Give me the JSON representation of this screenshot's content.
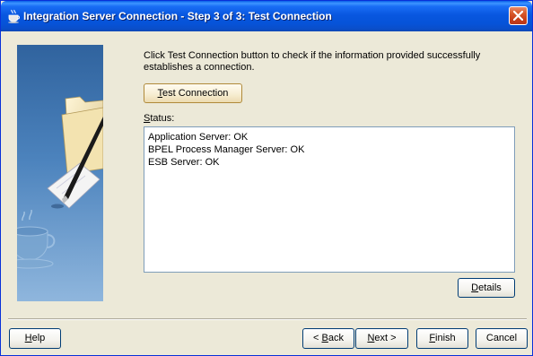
{
  "window": {
    "title": "Integration Server Connection - Step 3 of 3: Test Connection",
    "icon": "java-coffee-cup-icon",
    "close_icon": "close-x-icon",
    "accent_color": "#0a5fe8",
    "close_color": "#d85a2c"
  },
  "main": {
    "instructions_line1": "Click Test Connection button to check if the information provided successfully",
    "instructions_line2": "establishes a connection.",
    "test_button": {
      "mnemonic": "T",
      "rest": "est Connection"
    },
    "status_label": {
      "mnemonic": "S",
      "rest": "tatus:"
    },
    "status_lines": [
      "Application Server: OK",
      "BPEL Process Manager Server: OK",
      "ESB Server: OK"
    ],
    "details_button": {
      "mnemonic": "D",
      "rest": "etails"
    }
  },
  "footer": {
    "help_button": {
      "mnemonic": "H",
      "rest": "elp"
    },
    "back_button": {
      "prefix": "< ",
      "mnemonic": "B",
      "rest": "ack"
    },
    "next_button": {
      "prefix": "",
      "mnemonic": "N",
      "rest": "ext >"
    },
    "finish_button": {
      "mnemonic": "F",
      "rest": "inish"
    },
    "cancel_button": {
      "label": "Cancel"
    }
  }
}
